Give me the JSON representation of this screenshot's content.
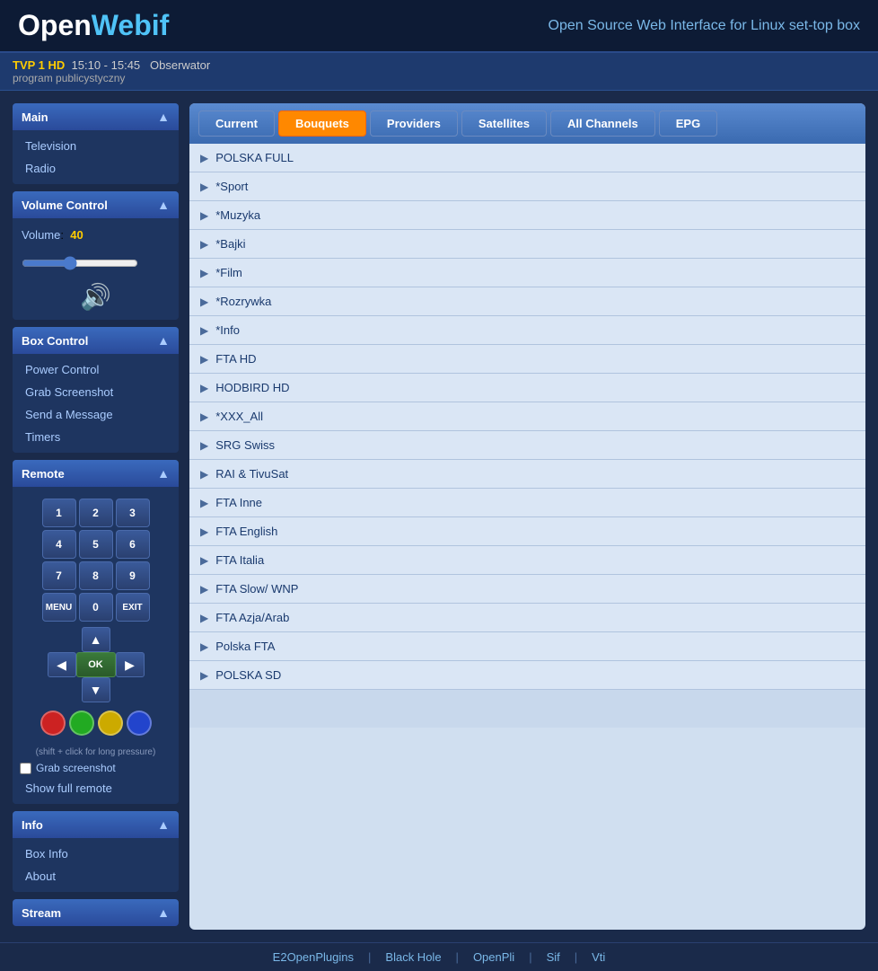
{
  "header": {
    "logo_open": "Open",
    "logo_webif": "Webif",
    "tagline": "Open Source Web Interface for Linux set-top box"
  },
  "nowplaying": {
    "channel": "TVP 1 HD",
    "time": "15:10 - 15:45",
    "show": "Obserwator",
    "desc": "program publicystyczny"
  },
  "sidebar": {
    "main_label": "Main",
    "main_items": [
      {
        "label": "Television",
        "id": "television"
      },
      {
        "label": "Radio",
        "id": "radio"
      }
    ],
    "volume_label": "Volume",
    "volume_section": "Volume Control",
    "volume_value": "40",
    "box_control_label": "Box Control",
    "box_items": [
      {
        "label": "Power Control",
        "id": "power-control"
      },
      {
        "label": "Grab Screenshot",
        "id": "grab-screenshot"
      },
      {
        "label": "Send a Message",
        "id": "send-message"
      },
      {
        "label": "Timers",
        "id": "timers"
      }
    ],
    "remote_label": "Remote",
    "remote_buttons": {
      "row1": [
        "1",
        "2",
        "3"
      ],
      "row2": [
        "4",
        "5",
        "6"
      ],
      "row3": [
        "7",
        "8",
        "9"
      ],
      "row4": [
        "MENU",
        "0",
        "EXIT"
      ]
    },
    "grab_screenshot_label": "Grab screenshot",
    "show_full_remote_label": "Show full remote",
    "info_label": "Info",
    "info_items": [
      {
        "label": "Box Info",
        "id": "box-info"
      },
      {
        "label": "About",
        "id": "about"
      }
    ],
    "stream_label": "Stream"
  },
  "content": {
    "tabs": [
      {
        "label": "Current",
        "id": "current",
        "active": false
      },
      {
        "label": "Bouquets",
        "id": "bouquets",
        "active": true
      },
      {
        "label": "Providers",
        "id": "providers",
        "active": false
      },
      {
        "label": "Satellites",
        "id": "satellites",
        "active": false
      },
      {
        "label": "All Channels",
        "id": "all-channels",
        "active": false
      },
      {
        "label": "EPG",
        "id": "epg",
        "active": false
      }
    ],
    "bouquets": [
      "POLSKA FULL",
      "*Sport",
      "*Muzyka",
      "*Bajki",
      "*Film",
      "*Rozrywka",
      "*Info",
      "FTA HD",
      "HODBIRD HD",
      "*XXX_All",
      "SRG Swiss",
      "RAI & TivuSat",
      "FTA Inne",
      "FTA English",
      "FTA Italia",
      "FTA Slow/ WNP",
      "FTA Azja/Arab",
      "Polska FTA",
      "POLSKA SD"
    ]
  },
  "footer": {
    "links": [
      {
        "label": "E2OpenPlugins",
        "id": "e2openplugins"
      },
      {
        "label": "Black Hole",
        "id": "black-hole"
      },
      {
        "label": "OpenPli",
        "id": "openpli"
      },
      {
        "label": "Sif",
        "id": "sif"
      },
      {
        "label": "Vti",
        "id": "vti"
      }
    ]
  }
}
